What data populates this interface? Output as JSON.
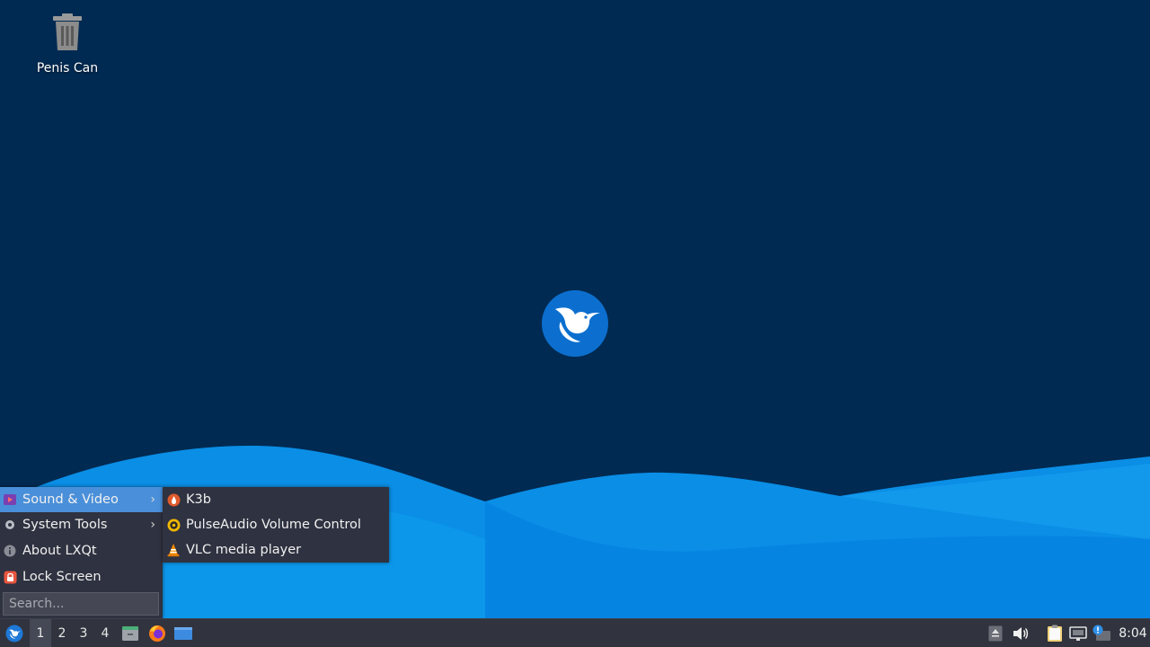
{
  "desktop": {
    "trash_label": "Penis Can"
  },
  "main_menu": {
    "items": [
      {
        "label": "Sound & Video",
        "icon": "sound-video-icon",
        "has_submenu": true,
        "active": true
      },
      {
        "label": "System Tools",
        "icon": "gear-icon",
        "has_submenu": true,
        "active": false
      },
      {
        "label": "About LXQt",
        "icon": "info-icon",
        "has_submenu": false,
        "active": false
      },
      {
        "label": "Lock Screen",
        "icon": "lock-icon",
        "has_submenu": false,
        "active": false
      }
    ],
    "search_placeholder": "Search..."
  },
  "sub_menu": {
    "items": [
      {
        "label": "K3b",
        "icon": "k3b-icon"
      },
      {
        "label": "PulseAudio Volume Control",
        "icon": "pulseaudio-icon"
      },
      {
        "label": "VLC media player",
        "icon": "vlc-cone-icon"
      }
    ]
  },
  "taskbar": {
    "workspaces": [
      "1",
      "2",
      "3",
      "4"
    ],
    "active_workspace": "1",
    "clock": "8:04"
  },
  "colors": {
    "desktop_bg": "#012a52",
    "menu_bg": "#2f3240",
    "menu_highlight": "#4a8fd9",
    "taskbar_bg": "#31343e"
  }
}
